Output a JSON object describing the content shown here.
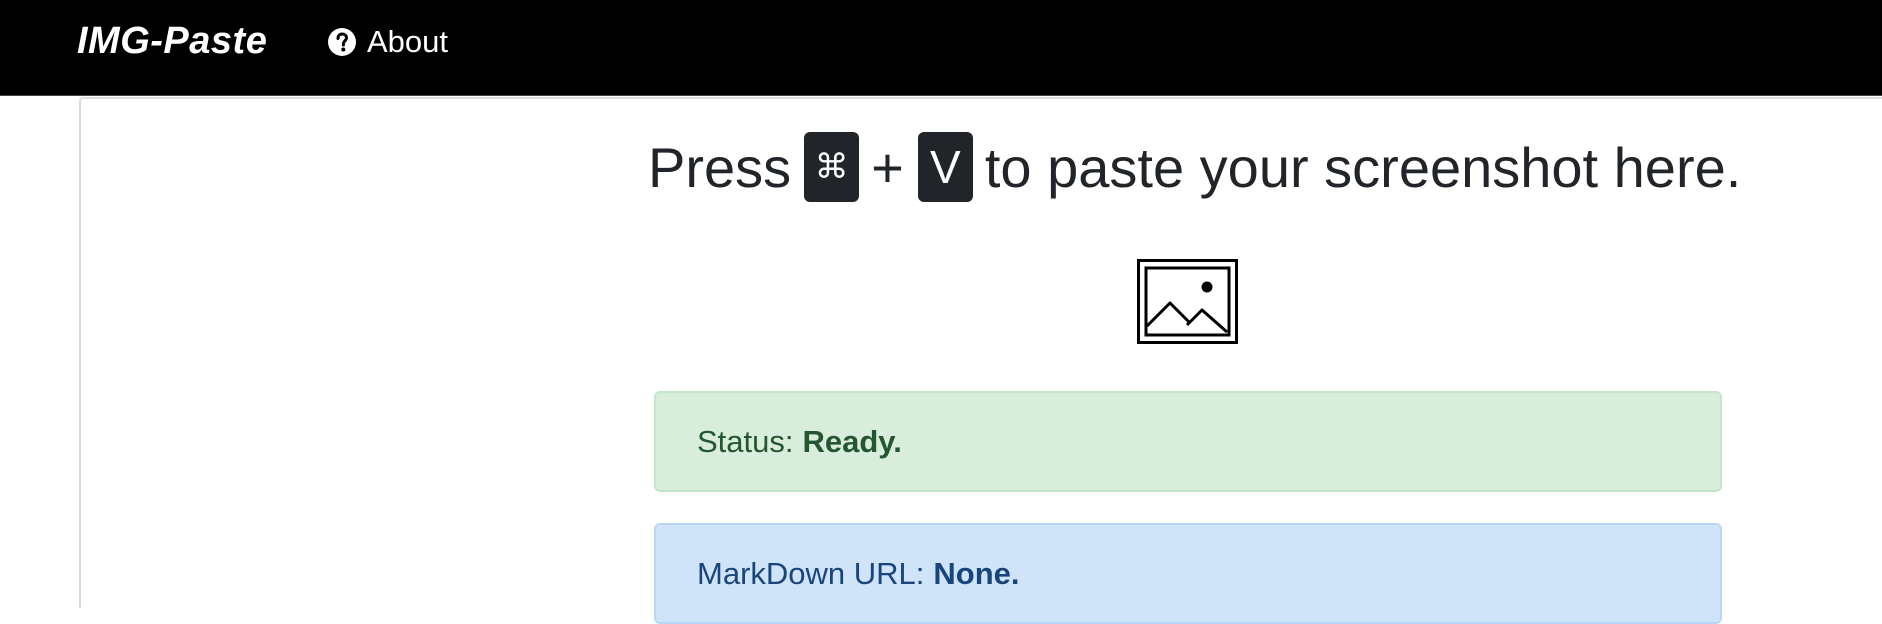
{
  "navbar": {
    "brand": "IMG-Paste",
    "about_label": "About",
    "background": "#000000"
  },
  "main": {
    "headline": {
      "prefix": "Press",
      "key1": "⌘",
      "plus": "+",
      "key2": "V",
      "suffix": "to paste your screenshot here."
    },
    "preview_icon": "image-placeholder-icon",
    "status": {
      "label": "Status:",
      "value": "Ready.",
      "color": "#d8eddc"
    },
    "markdown": {
      "label": "MarkDown URL:",
      "value": "None.",
      "color": "#d0e4f9"
    }
  }
}
